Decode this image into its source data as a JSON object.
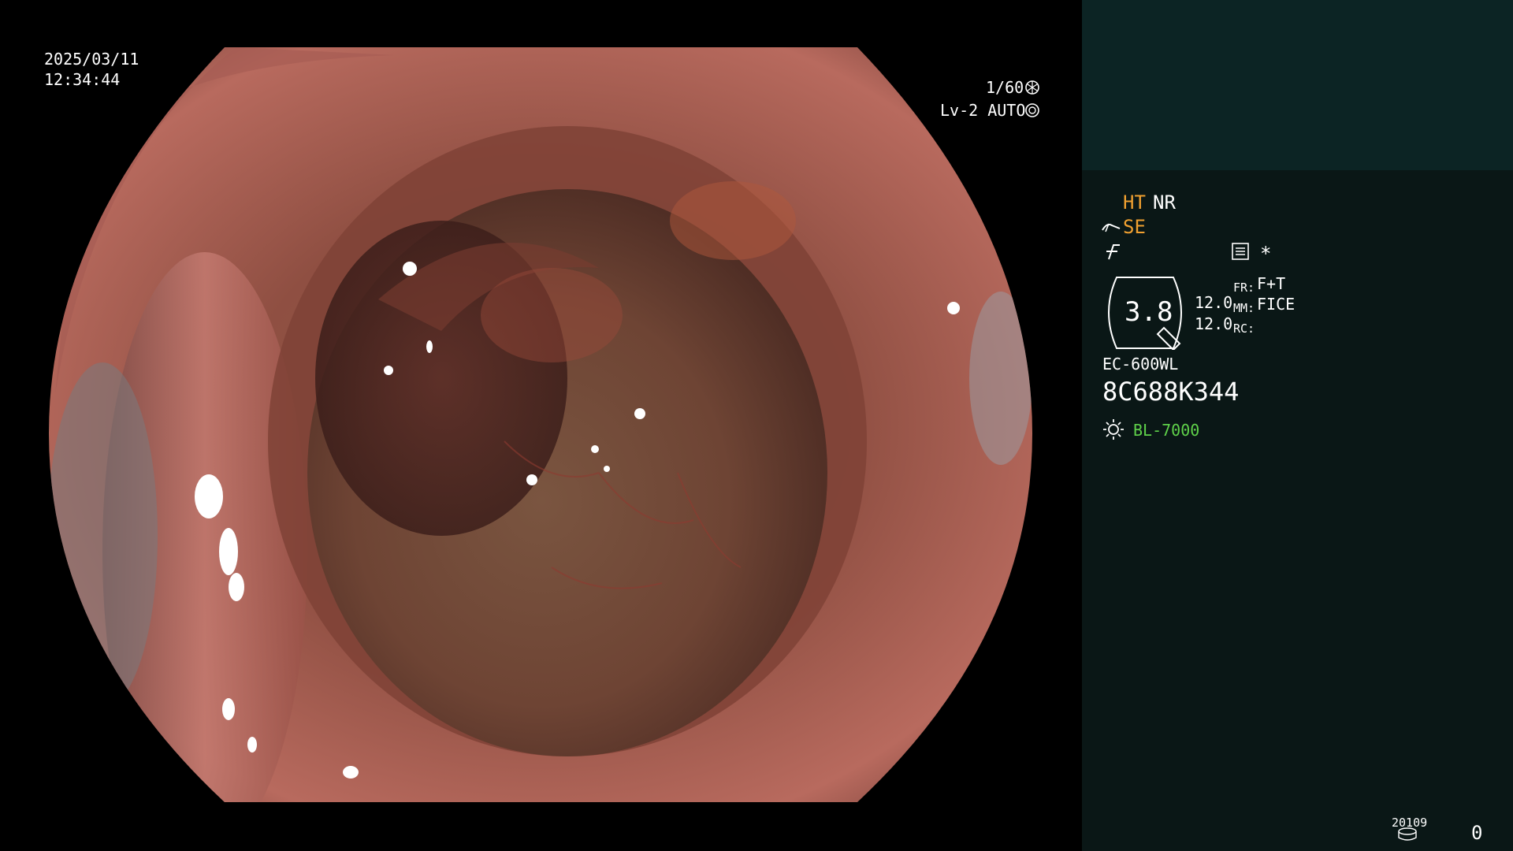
{
  "osd": {
    "date": "2025/03/11",
    "time": "12:34:44",
    "shutter": "1/60",
    "iris": "Lv-2 AUTO"
  },
  "panel": {
    "ht": "HT",
    "nr": "NR",
    "se": "SE",
    "zoom_value": "3.8",
    "val1": "12.0",
    "val2": "12.0",
    "fr_label": "FR:",
    "fr_value": "F+T",
    "mm_label": "MM:",
    "mm_value": "FICE",
    "rc_label": "RC:",
    "scope_model": "EC-600WL",
    "scope_serial": "8C688K344",
    "light_source": "BL-7000",
    "counter_label": "20109",
    "counter_value": "0",
    "asterisk": "*"
  },
  "colors": {
    "panel_bg": "#0a1716",
    "panel_top_bg": "#0c2424",
    "orange": "#f0a030",
    "green": "#5fd14a"
  },
  "icons": [
    "shutter-icon",
    "iris-icon",
    "scope-tip-icon",
    "freeze-icon",
    "menu-icon",
    "light-source-icon",
    "storage-icon"
  ]
}
